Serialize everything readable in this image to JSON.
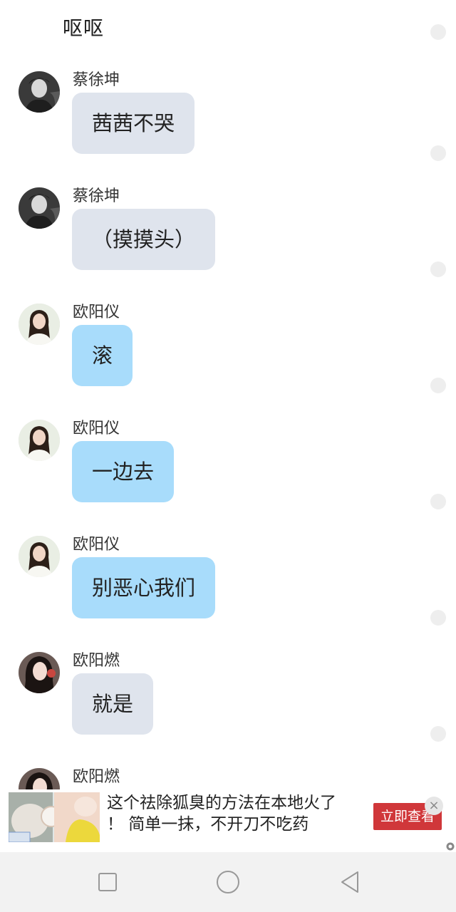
{
  "header": {
    "top_text": "呕呕"
  },
  "messages": [
    {
      "sender": "蔡徐坤",
      "text": "茜茜不哭",
      "bubble": "gray",
      "avatar": "male-avatar"
    },
    {
      "sender": "蔡徐坤",
      "text": "（摸摸头）",
      "bubble": "gray",
      "avatar": "male-avatar"
    },
    {
      "sender": "欧阳仪",
      "text": "滚",
      "bubble": "blue",
      "avatar": "female-avatar"
    },
    {
      "sender": "欧阳仪",
      "text": "一边去",
      "bubble": "blue",
      "avatar": "female-avatar"
    },
    {
      "sender": "欧阳仪",
      "text": "别恶心我们",
      "bubble": "blue",
      "avatar": "female-avatar"
    },
    {
      "sender": "欧阳燃",
      "text": "就是",
      "bubble": "gray",
      "avatar": "female-avatar"
    },
    {
      "sender": "欧阳燃",
      "text": "",
      "bubble": "gray",
      "avatar": "female-avatar"
    }
  ],
  "ad": {
    "text_line1": "这个祛除狐臭的方法在本地火了",
    "text_line2": "！ 简单一抹，不开刀不吃药",
    "button_label": "立即查看",
    "close_symbol": "×"
  },
  "colors": {
    "bubble_gray": "#dfe4ed",
    "bubble_blue": "#a8dcfb",
    "ad_button": "#d0373a",
    "nav_bg": "#f2f2f2"
  },
  "nav": {
    "icons": [
      "square-icon",
      "circle-icon",
      "back-triangle-icon"
    ]
  }
}
